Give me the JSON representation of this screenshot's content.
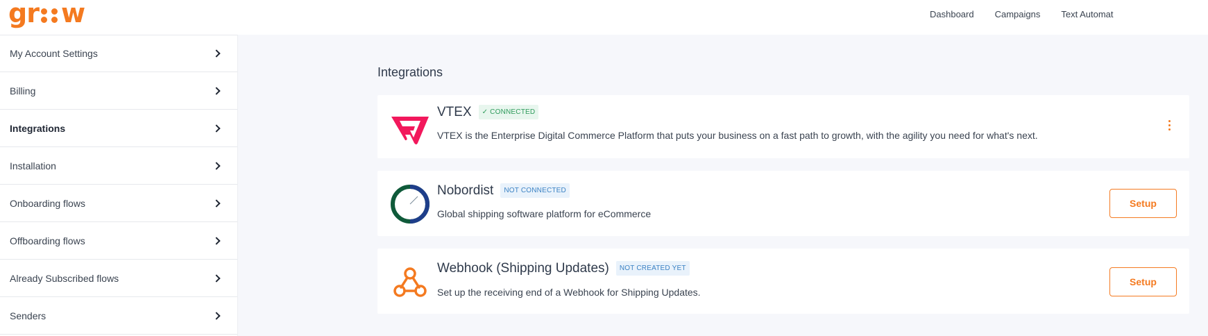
{
  "brand": {
    "logo_text_left": "gr",
    "logo_text_right": "w",
    "accent": "#f47a20"
  },
  "nav": [
    {
      "label": "Dashboard"
    },
    {
      "label": "Campaigns"
    },
    {
      "label": "Text Automat"
    }
  ],
  "sidebar": {
    "items": [
      {
        "label": "My Account Settings",
        "active": false
      },
      {
        "label": "Billing",
        "active": false
      },
      {
        "label": "Integrations",
        "active": true
      },
      {
        "label": "Installation",
        "active": false
      },
      {
        "label": "Onboarding flows",
        "active": false
      },
      {
        "label": "Offboarding flows",
        "active": false
      },
      {
        "label": "Already Subscribed flows",
        "active": false
      },
      {
        "label": "Senders",
        "active": false
      }
    ]
  },
  "main": {
    "title": "Integrations",
    "integrations": [
      {
        "name": "VTEX",
        "status": "✓ CONNECTED",
        "description": "VTEX is the Enterprise Digital Commerce Platform that puts your business on a fast path to growth, with the agility you need for what's next.",
        "icon": "vtex-logo-icon"
      },
      {
        "name": "Nobordist",
        "status": "NOT CONNECTED",
        "description": "Global shipping software platform for eCommerce",
        "action": "Setup",
        "icon": "nobordist-logo-icon"
      },
      {
        "name": "Webhook (Shipping Updates)",
        "status": "NOT CREATED YET",
        "description": "Set up the receiving end of a Webhook for Shipping Updates.",
        "action": "Setup",
        "icon": "webhook-icon"
      }
    ]
  }
}
